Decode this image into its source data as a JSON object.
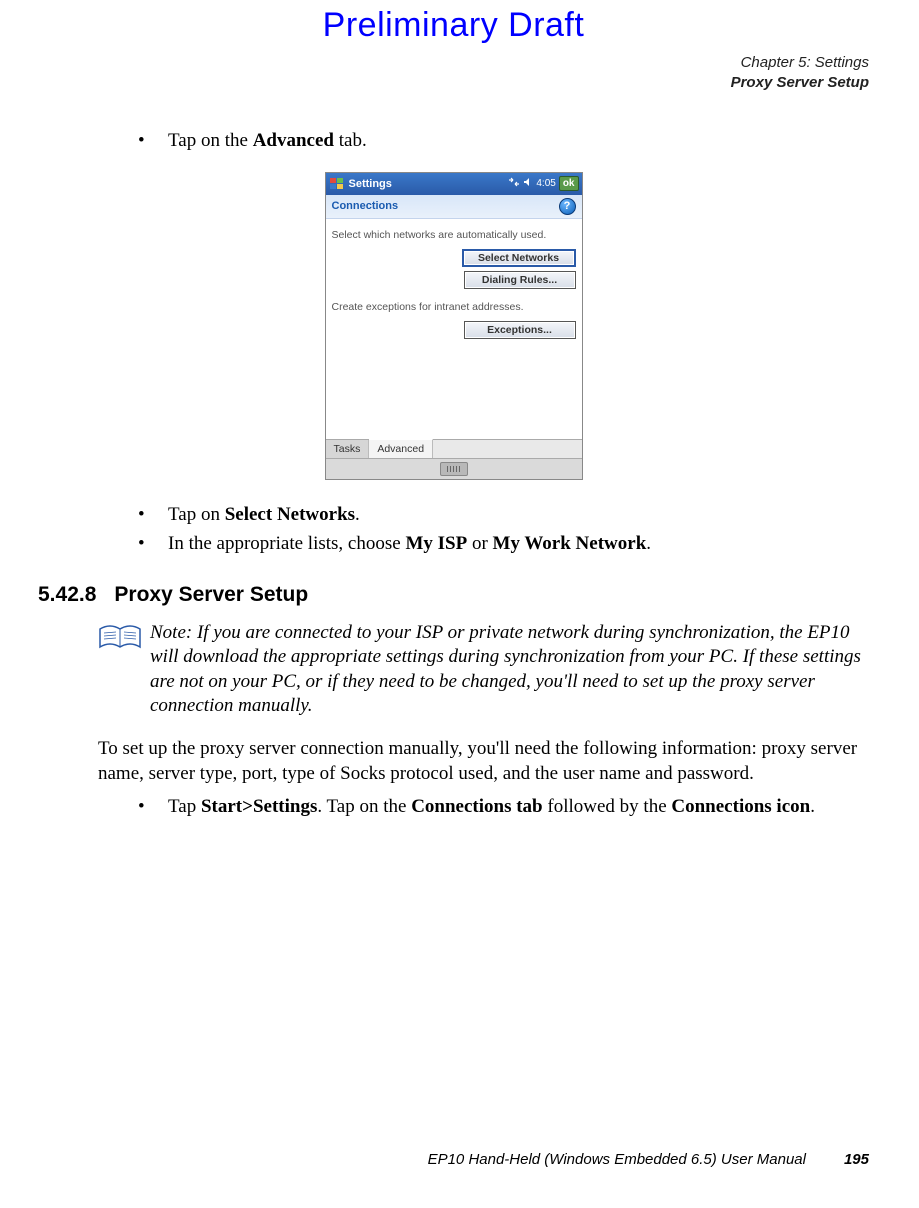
{
  "draft_header": "Preliminary Draft",
  "header": {
    "chapter": "Chapter 5:  Settings",
    "section": "Proxy Server Setup"
  },
  "bullets_before": [
    {
      "pre": "Tap on the ",
      "bold": "Advanced",
      "post": " tab."
    }
  ],
  "screenshot": {
    "titlebar": "Settings",
    "status_time": "4:05",
    "ok": "ok",
    "header": "Connections",
    "help": "?",
    "text1": "Select which networks are automatically used.",
    "btn_select_networks": "Select Networks",
    "btn_dialing_rules": "Dialing Rules...",
    "text2": "Create exceptions for intranet addresses.",
    "btn_exceptions": "Exceptions...",
    "tab_tasks": "Tasks",
    "tab_advanced": "Advanced"
  },
  "bullets_after": [
    {
      "pre": "Tap on ",
      "bold": "Select Networks",
      "post": "."
    },
    {
      "pre": "In the appropriate lists, choose ",
      "bold": "My ISP",
      "mid": " or ",
      "bold2": "My Work Network",
      "post": "."
    }
  ],
  "section": {
    "number": "5.42.8",
    "title": "Proxy Server Setup"
  },
  "note": {
    "label": "Note:",
    "text": "If you are connected to your ISP or private network during synchronization, the EP10 will download the appropriate settings during synchronization from your PC. If these settings are not on your PC, or if they need to be changed, you'll need to set up the proxy server connection manually."
  },
  "para1": "To set up the proxy server connection manually, you'll need the following information: proxy server name, server type, port, type of Socks protocol used, and the user name and password.",
  "bullet_last": {
    "pre": "Tap ",
    "b1": "Start>Settings",
    "mid1": ". Tap on the ",
    "b2": "Connections tab",
    "mid2": " followed by the ",
    "b3": "Connections icon",
    "post": "."
  },
  "footer": {
    "manual": "EP10 Hand-Held (Windows Embedded 6.5) User Manual",
    "page": "195"
  }
}
